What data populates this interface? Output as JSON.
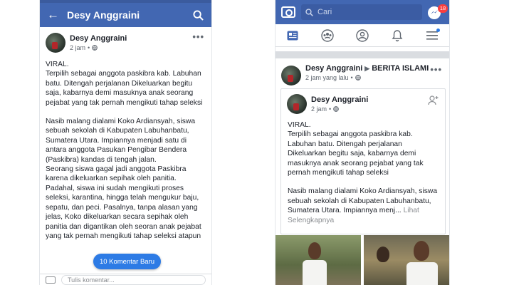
{
  "left": {
    "header": {
      "title": "Desy Anggraini"
    },
    "post": {
      "author": "Desy Anggraini",
      "time": "2 jam",
      "sep": "•",
      "paragraphs": [
        "VIRAL.\nTerpilih sebagai anggota paskibra kab. Labuhan batu. Ditengah perjalanan Dikeluarkan begitu saja, kabarnya demi masuknya anak seorang pejabat yang tak pernah mengikuti tahap seleksi",
        "Nasib malang dialami Koko Ardiansyah, siswa sebuah sekolah di Kabupaten Labuhanbatu, Sumatera Utara. Impiannya menjadi satu di antara anggota Pasukan Pengibar Bendera (Paskibra) kandas di tengah jalan.\nSeorang siswa gagal jadi anggota Paskibra karena dikeluarkan sepihak oleh panitia.\nPadahal, siswa ini sudah mengikuti proses seleksi, karantina, hingga telah mengukur baju, sepatu, dan peci. Pasalnya, tanpa alasan yang jelas, Koko dikeluarkan secara sepihak oleh panitia dan digantikan oleh seoran anak pejabat yang tak pernah mengikuti tahap seleksi atapun"
      ]
    },
    "new_comments": "10 Komentar Baru",
    "comment_placeholder": "Tulis komentar..."
  },
  "right": {
    "search_placeholder": "Cari",
    "messenger_badge": "18",
    "share_post": {
      "author": "Desy Anggraini",
      "arrow": "▶",
      "page": "BERITA ISLAMI",
      "time": "2 jam yang lalu",
      "sep": "•"
    },
    "original_post": {
      "author": "Desy Anggraini",
      "time": "2 jam",
      "sep": "•",
      "paragraphs": [
        "VIRAL.\nTerpilih sebagai anggota paskibra kab. Labuhan batu. Ditengah perjalanan Dikeluarkan begitu saja, kabarnya demi masuknya anak seorang pejabat yang tak pernah mengikuti tahap seleksi",
        "Nasib malang dialami Koko Ardiansyah, siswa sebuah sekolah di Kabupaten Labuhanbatu, Sumatera Utara. Impiannya menj..."
      ],
      "see_more": "Lihat Selengkapnya"
    }
  },
  "colors": {
    "brand": "#4267b2",
    "accent": "#2d7be5",
    "badge": "#fa3e3e"
  },
  "icons": [
    "back-arrow-icon",
    "search-icon",
    "camera-icon",
    "messenger-icon",
    "news-feed-icon",
    "groups-icon",
    "profile-icon",
    "bell-icon",
    "menu-icon",
    "globe-icon",
    "add-friend-icon",
    "more-icon"
  ]
}
